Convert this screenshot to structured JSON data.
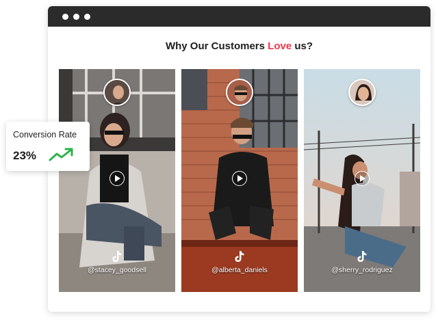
{
  "window": {
    "dots": 3
  },
  "heading": {
    "prefix": "Why Our Customers ",
    "accent": "Love",
    "suffix": " us?",
    "accent_color": "#f2364b"
  },
  "cards": [
    {
      "handle": "@stacey_goodsell",
      "play_icon": "play-icon",
      "brand_icon": "tiktok-icon"
    },
    {
      "handle": "@alberta_daniels",
      "play_icon": "play-icon",
      "brand_icon": "tiktok-icon"
    },
    {
      "handle": "@sherry_rodriguez",
      "play_icon": "play-icon",
      "brand_icon": "tiktok-icon"
    }
  ],
  "conversion": {
    "label": "Conversion Rate",
    "value": "23%",
    "trend_icon": "trend-up-icon",
    "trend_color": "#2db34a"
  }
}
